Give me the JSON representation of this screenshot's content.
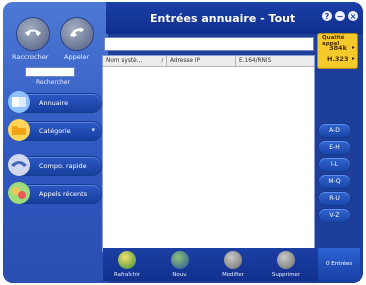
{
  "window": {
    "title": "Entrées annuaire - Tout",
    "controls": [
      "?",
      "−",
      "×"
    ]
  },
  "sidebar": {
    "hangup_label": "Raccrocher",
    "call_label": "Appeler",
    "search_label": "Rechercher",
    "search_value": "",
    "nav": [
      {
        "label": "Annuaire"
      },
      {
        "label": "Catégorie",
        "chevron": "▾"
      },
      {
        "label": "Compo. rapide"
      },
      {
        "label": "Appels récents"
      }
    ]
  },
  "address_bar": {
    "value": ""
  },
  "quality": {
    "label": "Qualité appel",
    "value1": "384k",
    "value2": "H.323",
    "arrow": "▸"
  },
  "table": {
    "columns": [
      "Nom systè...",
      "Adresse IP",
      "E.164/RNIS"
    ],
    "sort_indicator": "/",
    "rows": []
  },
  "alpha_buttons": [
    "A-D",
    "E-H",
    "I-L",
    "M-Q",
    "R-U",
    "V-Z"
  ],
  "toolbar": {
    "refresh": "Rafraîchir",
    "new": "Nouv.",
    "edit": "Modifier",
    "delete": "Supprimer"
  },
  "status": {
    "text": "0 Entrées"
  },
  "colors": {
    "frame": "#1d3f9a",
    "sidebar": "#3f6ad0",
    "accent_yellow": "#f5ca2a",
    "white": "#ffffff"
  }
}
